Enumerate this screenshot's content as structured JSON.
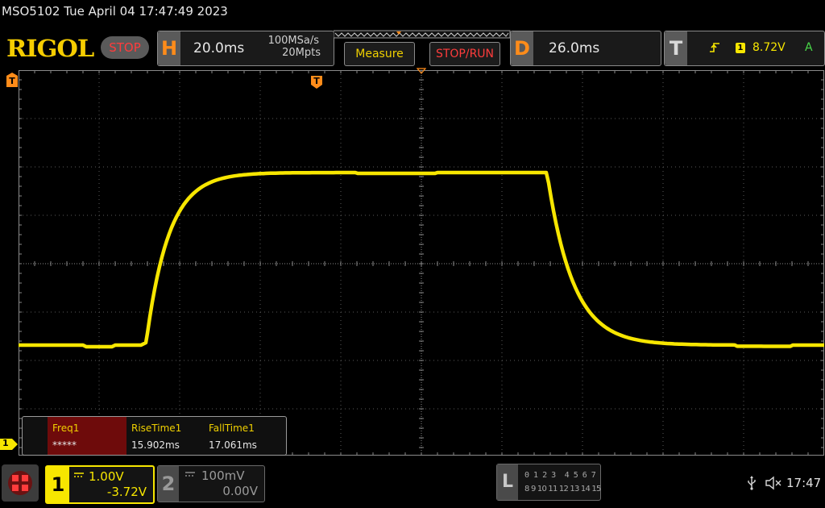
{
  "title": "MSO5102  Tue April 04 17:47:49 2023",
  "brand": "RIGOL",
  "run_state": "STOP",
  "horizontal": {
    "letter": "H",
    "timebase": "20.0ms",
    "sample_rate": "100MSa/s",
    "memory_depth": "20Mpts"
  },
  "buttons": {
    "measure": "Measure",
    "stop_run": "STOP/RUN"
  },
  "delay": {
    "letter": "D",
    "value": "26.0ms"
  },
  "trigger": {
    "letter": "T",
    "source_channel": "1",
    "level": "8.72V",
    "mode": "A"
  },
  "markers": {
    "channel1": "1",
    "trigger_marker": "T"
  },
  "measurements": [
    {
      "label": "Freq1",
      "value": "*****"
    },
    {
      "label": "RiseTime1",
      "value": "15.902ms"
    },
    {
      "label": "FallTime1",
      "value": "17.061ms"
    }
  ],
  "channel1": {
    "number": "1",
    "scale": "1.00V",
    "offset": "-3.72V",
    "color": "#f7e600"
  },
  "channel2": {
    "number": "2",
    "scale": "100mV",
    "offset": "0.00V"
  },
  "logic": {
    "letter": "L",
    "row1": "0 1 2 3  4 5 6 7",
    "row2": "8 9 10 11 12 13 14 15"
  },
  "status": {
    "time": "17:47"
  },
  "colors": {
    "accent_orange": "#ff8c1a",
    "trace_yellow": "#f7e600",
    "stop_red": "#ff3c3c",
    "label_yellow": "#f0d000"
  },
  "icons": [
    "usb-icon",
    "speaker-muted-icon",
    "menu-grid-icon"
  ]
}
